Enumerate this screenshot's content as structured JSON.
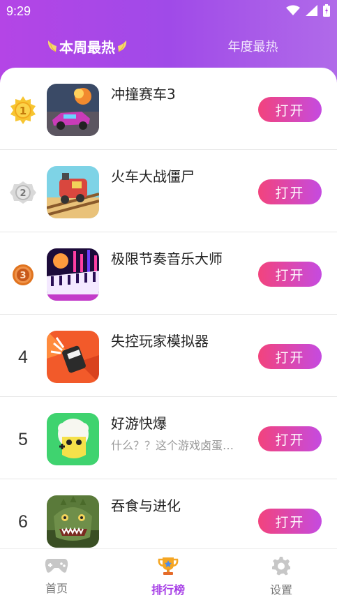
{
  "status_bar": {
    "time": "9:29"
  },
  "tabs": {
    "weekly": "本周最热",
    "yearly": "年度最热"
  },
  "rows": [
    {
      "rank": "1",
      "name": "冲撞赛车3",
      "desc": "",
      "button": "打开"
    },
    {
      "rank": "2",
      "name": "火车大战僵尸",
      "desc": "",
      "button": "打开"
    },
    {
      "rank": "3",
      "name": "极限节奏音乐大师",
      "desc": "",
      "button": "打开"
    },
    {
      "rank": "4",
      "name": "失控玩家模拟器",
      "desc": "",
      "button": "打开"
    },
    {
      "rank": "5",
      "name": "好游快爆",
      "desc": "什么？？这个游戏卤蛋…",
      "button": "打开"
    },
    {
      "rank": "6",
      "name": "吞食与进化",
      "desc": "",
      "button": "打开"
    }
  ],
  "nav": {
    "home": "首页",
    "ranking": "排行榜",
    "settings": "设置"
  },
  "colors": {
    "accent": "#a63ee6",
    "button_start": "#f2437d",
    "button_end": "#c54be0",
    "header": "#b445e6"
  }
}
